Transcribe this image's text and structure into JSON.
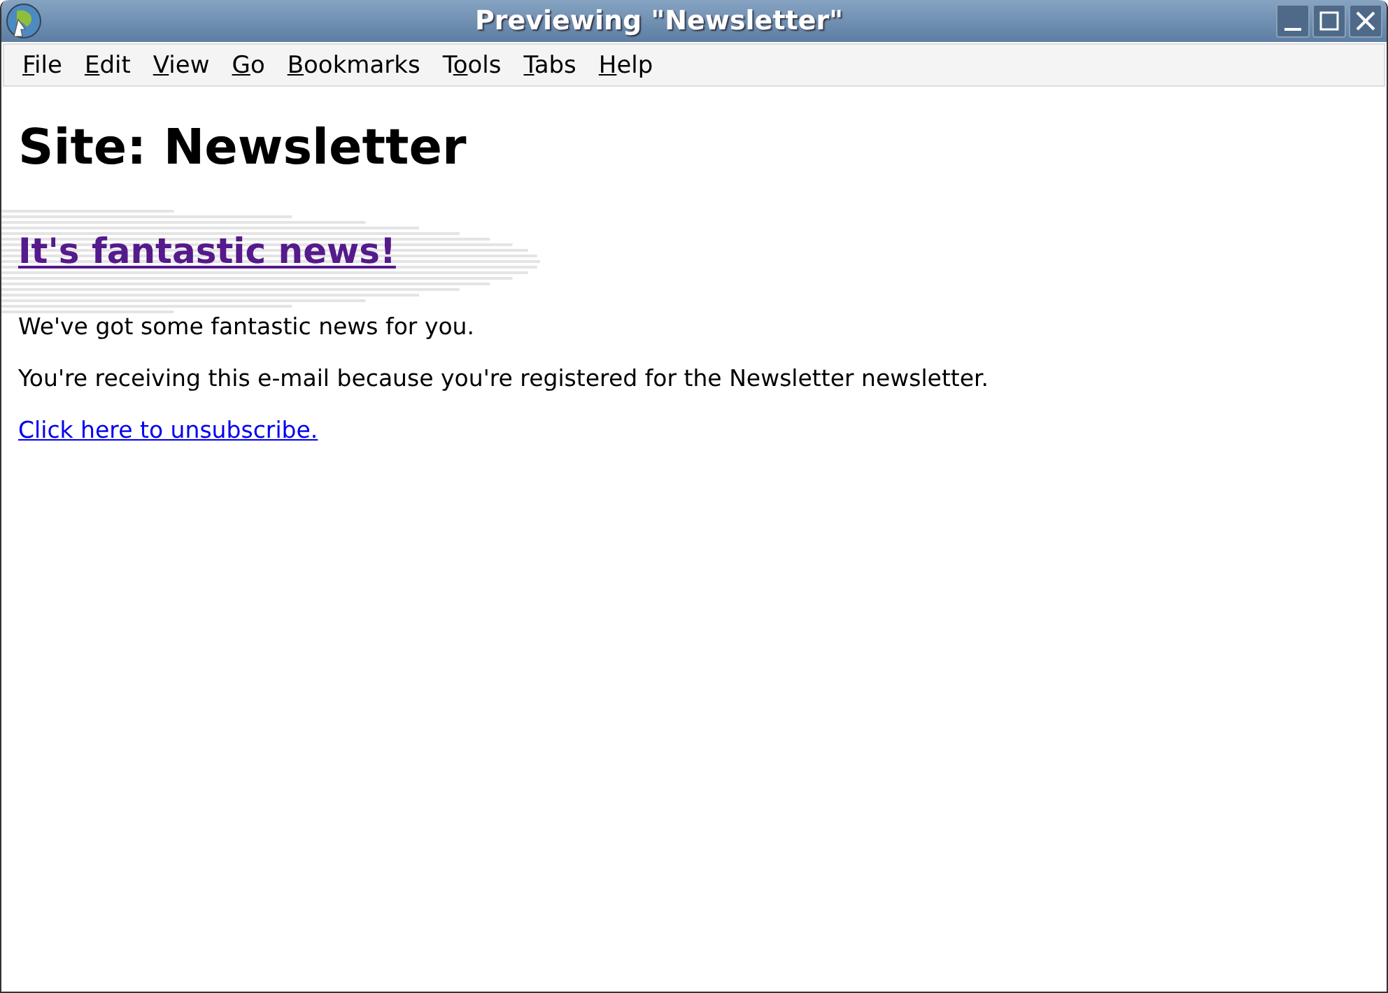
{
  "window": {
    "title": "Previewing \"Newsletter\""
  },
  "menu": [
    {
      "label": "File",
      "mnemonic_on_second_letter": false
    },
    {
      "label": "Edit",
      "mnemonic_on_second_letter": false
    },
    {
      "label": "View",
      "mnemonic_on_second_letter": false
    },
    {
      "label": "Go",
      "mnemonic_on_second_letter": false
    },
    {
      "label": "Bookmarks",
      "mnemonic_on_second_letter": false
    },
    {
      "label": "Tools",
      "mnemonic_on_second_letter": true
    },
    {
      "label": "Tabs",
      "mnemonic_on_second_letter": false
    },
    {
      "label": "Help",
      "mnemonic_on_second_letter": false
    }
  ],
  "page": {
    "heading": "Site: Newsletter",
    "article_link": {
      "text": "It's fantastic news!",
      "visited": true
    },
    "paragraphs": [
      "We've got some fantastic news for you.",
      "You're receiving this e-mail because you're registered for the Newsletter newsletter."
    ],
    "unsubscribe_link": {
      "text": "Click here to unsubscribe.",
      "visited": false
    }
  }
}
